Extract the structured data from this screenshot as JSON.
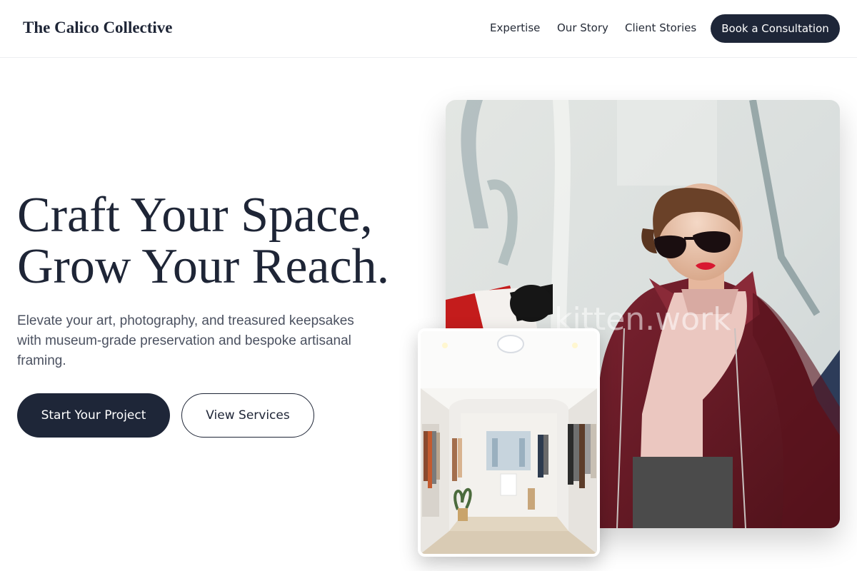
{
  "header": {
    "brand": "The Calico Collective",
    "nav": {
      "expertise": "Expertise",
      "story": "Our Story",
      "clients": "Client Stories"
    },
    "cta": "Book a Consultation"
  },
  "hero": {
    "headline_line1": "Craft Your Space,",
    "headline_line2": "Grow Your Reach.",
    "subtext": "Elevate your art, photography, and treasured keepsakes with museum-grade preservation and bespoke artisanal framing.",
    "primary_button": "Start Your Project",
    "secondary_button": "View Services",
    "watermark": "kitten.work"
  },
  "colors": {
    "navy": "#1e2638",
    "coat": "#6e1c25",
    "text_muted": "#4b5160"
  }
}
